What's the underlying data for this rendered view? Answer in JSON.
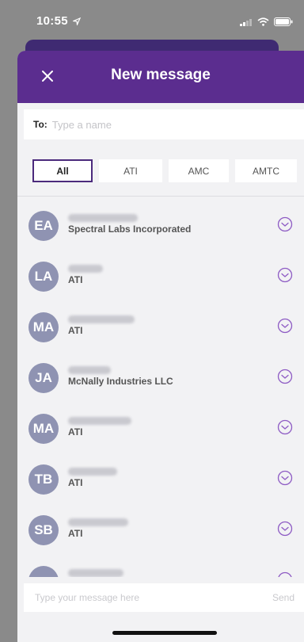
{
  "status_bar": {
    "time": "10:55"
  },
  "header": {
    "title": "New message"
  },
  "to_field": {
    "label": "To:",
    "placeholder": "Type a name"
  },
  "filters": [
    {
      "label": "All",
      "active": true
    },
    {
      "label": "ATI",
      "active": false
    },
    {
      "label": "AMC",
      "active": false
    },
    {
      "label": "AMTC",
      "active": false
    }
  ],
  "contacts": [
    {
      "initials": "EA",
      "org": "Spectral Labs Incorporated"
    },
    {
      "initials": "LA",
      "org": "ATI"
    },
    {
      "initials": "MA",
      "org": "ATI"
    },
    {
      "initials": "JA",
      "org": "McNally Industries LLC"
    },
    {
      "initials": "MA",
      "org": "ATI"
    },
    {
      "initials": "TB",
      "org": "ATI"
    },
    {
      "initials": "SB",
      "org": "ATI"
    },
    {
      "initials": "",
      "org": ""
    }
  ],
  "compose": {
    "placeholder": "Type your message here",
    "send_label": "Send"
  },
  "colors": {
    "header": "#5b2d8f",
    "accent": "#8e5cc4",
    "avatar": "#8f93b2"
  }
}
